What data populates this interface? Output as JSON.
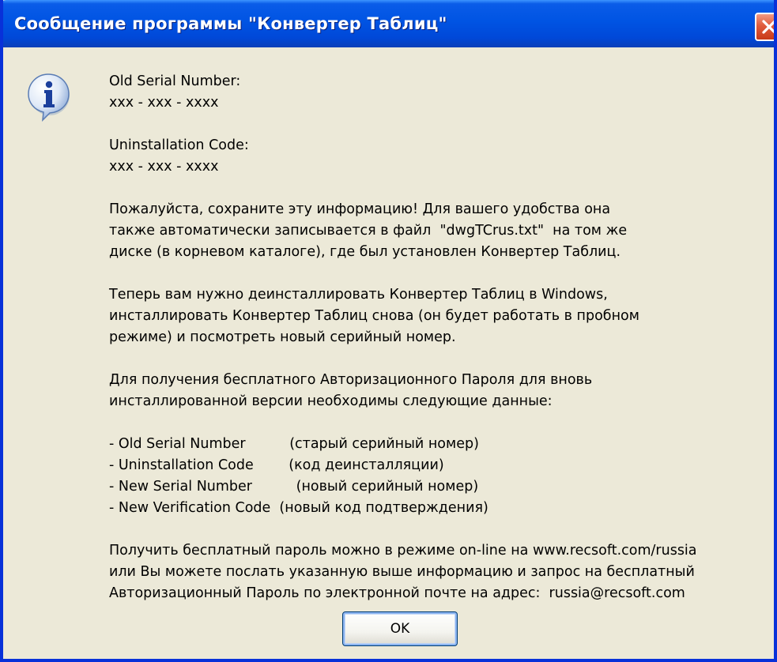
{
  "window": {
    "title": "Сообщение программы \"Конвертер Таблиц\""
  },
  "icons": {
    "info": "info-icon",
    "close": "close-icon"
  },
  "message": {
    "lines": [
      "Old Serial Number:",
      "xxx - xxx - xxxx",
      "",
      "Uninstallation Code:",
      "xxx - xxx - xxxx",
      "",
      "Пожалуйста, сохраните эту информацию! Для вашего удобства она",
      "также автоматически записывается в файл  \"dwgTCrus.txt\"  на том же",
      "диске (в корневом каталоге), где был установлен Конвертер Таблиц.",
      "",
      "Теперь вам нужно деинсталлировать Конвертер Таблиц в Windows,",
      "инсталлировать Конвертер Таблиц снова (он будет работать в пробном",
      "режиме) и посмотреть новый серийный номер.",
      "",
      "Для получения бесплатного Авторизационного Пароля для вновь",
      "инсталлированной версии необходимы следующие данные:",
      "",
      "- Old Serial Number          (старый серийный номер)",
      "- Uninstallation Code        (код деинсталляции)",
      "- New Serial Number          (новый серийный номер)",
      "- New Verification Code  (новый код подтверждения)",
      "",
      "Получить бесплатный пароль можно в режиме on-line на www.recsoft.com/russia",
      "или Вы можете послать указанную выше информацию и запрос на бесплатный",
      "Авторизационный Пароль по электронной почте на адрес:  russia@recsoft.com"
    ]
  },
  "buttons": {
    "ok_label": "OK"
  },
  "colors": {
    "title_bar": "#0054e3",
    "dialog_bg": "#ece9d8",
    "close_button": "#e05c3c"
  }
}
